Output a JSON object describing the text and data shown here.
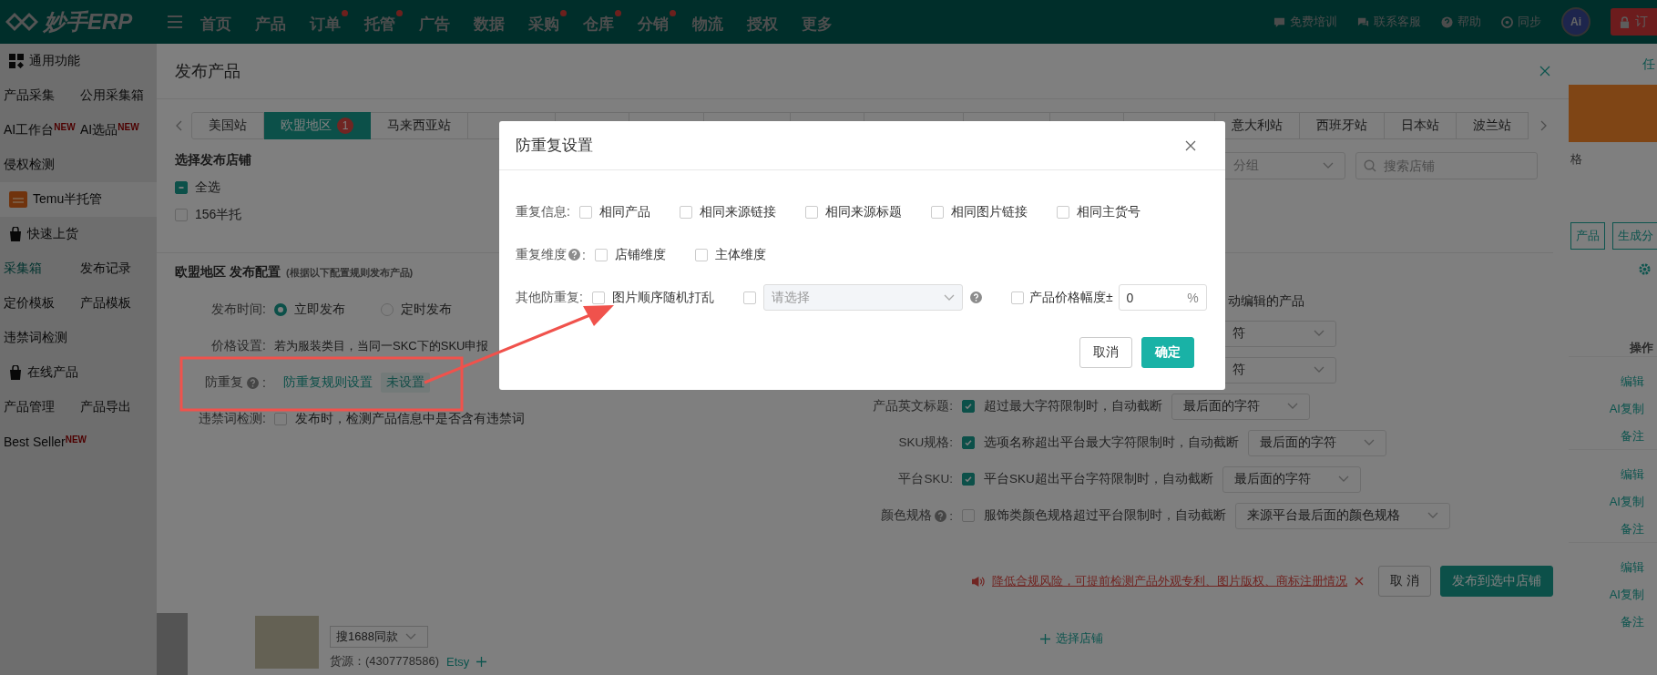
{
  "topbar": {
    "logo": "妙手ERP",
    "nav": [
      {
        "label": "首页",
        "dot": false
      },
      {
        "label": "产品",
        "dot": false
      },
      {
        "label": "订单",
        "dot": true
      },
      {
        "label": "托管",
        "dot": true
      },
      {
        "label": "广告",
        "dot": false
      },
      {
        "label": "数据",
        "dot": false
      },
      {
        "label": "采购",
        "dot": true
      },
      {
        "label": "仓库",
        "dot": true
      },
      {
        "label": "分销",
        "dot": true
      },
      {
        "label": "物流",
        "dot": false
      },
      {
        "label": "授权",
        "dot": false
      },
      {
        "label": "更多",
        "dot": false
      }
    ],
    "tools": [
      {
        "kind": "training",
        "label": "免费培训"
      },
      {
        "kind": "service",
        "label": "联系客服"
      },
      {
        "kind": "help",
        "label": "帮助"
      },
      {
        "kind": "sync",
        "label": "同步"
      }
    ],
    "avatar": "Ai",
    "order_button": "订"
  },
  "sidebar": [
    {
      "kind": "heading",
      "items": [
        {
          "label": "通用功能",
          "selected": false
        }
      ]
    },
    {
      "kind": "plain",
      "items": [
        {
          "label": "产品采集",
          "selected": false
        },
        {
          "label": "公用采集箱",
          "selected": false
        }
      ]
    },
    {
      "kind": "plain",
      "items": [
        {
          "label": "AI工作台",
          "badge": "NEW",
          "selected": false
        },
        {
          "label": "AI选品",
          "badge": "NEW",
          "selected": false
        }
      ]
    },
    {
      "kind": "plain",
      "items": [
        {
          "label": "侵权检测",
          "selected": false
        }
      ]
    },
    {
      "kind": "app",
      "items": [
        {
          "label": "Temu半托管",
          "selected": false
        }
      ]
    },
    {
      "kind": "shortcut",
      "items": [
        {
          "label": "快速上货",
          "selected": false
        }
      ]
    },
    {
      "kind": "plain",
      "items": [
        {
          "label": "采集箱",
          "selected": true
        },
        {
          "label": "发布记录",
          "selected": false
        }
      ]
    },
    {
      "kind": "plain",
      "items": [
        {
          "label": "定价模板",
          "selected": false
        },
        {
          "label": "产品模板",
          "selected": false
        }
      ]
    },
    {
      "kind": "plain",
      "items": [
        {
          "label": "违禁词检测",
          "selected": false
        }
      ]
    },
    {
      "kind": "shortcut",
      "items": [
        {
          "label": "在线产品",
          "selected": false
        }
      ]
    },
    {
      "kind": "plain",
      "items": [
        {
          "label": "产品管理",
          "selected": false
        },
        {
          "label": "产品导出",
          "selected": false
        }
      ]
    },
    {
      "kind": "plain",
      "items": [
        {
          "label": "Best Seller",
          "badge": "NEW",
          "selected": false
        }
      ]
    }
  ],
  "page": {
    "corner_text": "任",
    "column_fragment": "格",
    "buttons": [
      "产品",
      "生成分"
    ],
    "actions_header": "操作",
    "action_groups": [
      [
        "编辑",
        "AI复制",
        "备注"
      ],
      [
        "编辑",
        "AI复制",
        "备注"
      ],
      [
        "编辑",
        "AI复制",
        "备注"
      ]
    ],
    "product": {
      "source_select": "搜1688同款",
      "source": "货源：(4307778586)",
      "platform": "Etsy",
      "store_action": "选择店铺"
    }
  },
  "publish_dialog": {
    "title": "发布产品",
    "tabs": [
      {
        "label": "美国站",
        "selected": false
      },
      {
        "label": "欧盟地区",
        "selected": true,
        "badge": "1"
      },
      {
        "label": "马来西亚站",
        "selected": false
      }
    ],
    "tabs_right": [
      {
        "label": "意大利站",
        "selected": false
      },
      {
        "label": "西班牙站",
        "selected": false
      },
      {
        "label": "日本站",
        "selected": false
      },
      {
        "label": "波兰站",
        "selected": false
      }
    ],
    "store_title": "选择发布店铺",
    "stores": [
      {
        "label": "全选",
        "indeterminate": true
      },
      {
        "label": "156半托",
        "indeterminate": false
      }
    ],
    "group_select": {
      "placeholder": "分组"
    },
    "store_search": {
      "placeholder": "搜索店铺"
    },
    "config_title": "欧盟地区 发布配置",
    "config_hint": "(根据以下配置规则发布产品)",
    "publish_time": {
      "label": "发布时间:",
      "options": [
        {
          "label": "立即发布",
          "selected": true
        },
        {
          "label": "定时发布",
          "selected": false
        }
      ]
    },
    "price": {
      "label": "价格设置:",
      "text": "若为服装类目，当同一SKC下的SKU申报"
    },
    "dedupe": {
      "label": "防重复",
      "colon": ":",
      "link": "防重复规则设置",
      "tag": "未设置"
    },
    "banned_words": {
      "label": "违禁词检测:",
      "checked": false,
      "text": "发布时，检测产品信息中是否含有违禁词"
    },
    "edited_fragment": "动编辑的产品",
    "hidden_row_values": [
      "符",
      "符"
    ],
    "rules": [
      {
        "label": "产品英文标题:",
        "help": false,
        "checked": true,
        "text": "超过最大字符限制时，自动截断",
        "value": "最后面的字符"
      },
      {
        "label": "SKU规格:",
        "help": false,
        "checked": true,
        "text": "选项名称超出平台最大字符限制时，自动截断",
        "value": "最后面的字符"
      },
      {
        "label": "平台SKU:",
        "help": false,
        "checked": true,
        "text": "平台SKU超出平台字符限制时，自动截断",
        "value": "最后面的字符"
      },
      {
        "label": "颜色规格",
        "colon": ":",
        "help": true,
        "checked": false,
        "text": "服饰类颜色规格超过平台限制时，自动截断",
        "value": "来源平台最后面的颜色规格"
      }
    ],
    "notice": "降低合规风险，可提前检测产品外观专利、图片版权、商标注册情况",
    "buttons": [
      {
        "kind": "default",
        "label": "取 消"
      },
      {
        "kind": "primary",
        "label": "发布到选中店铺"
      }
    ]
  },
  "dedupe_dialog": {
    "title": "防重复设置",
    "rows": [
      {
        "label": "重复信息:",
        "help": false,
        "options": [
          {
            "kind": "checkbox",
            "label": "相同产品",
            "checked": false
          },
          {
            "kind": "checkbox",
            "label": "相同来源链接",
            "checked": false
          },
          {
            "kind": "checkbox",
            "label": "相同来源标题",
            "checked": false
          },
          {
            "kind": "checkbox",
            "label": "相同图片链接",
            "checked": false
          },
          {
            "kind": "checkbox",
            "label": "相同主货号",
            "checked": false
          }
        ]
      },
      {
        "label": "重复维度",
        "colon": ":",
        "help": true,
        "options": [
          {
            "kind": "checkbox",
            "label": "店铺维度",
            "checked": false
          },
          {
            "kind": "checkbox",
            "label": "主体维度",
            "checked": false
          }
        ]
      },
      {
        "label": "其他防重复:",
        "help": false,
        "options": [
          {
            "kind": "checkbox",
            "label": "图片顺序随机打乱",
            "checked": false
          },
          {
            "kind": "select",
            "checked": false,
            "placeholder": "请选择",
            "disabled": true
          },
          {
            "kind": "range",
            "checked": false,
            "label": "产品价格幅度±",
            "value": "0",
            "suffix": "%"
          }
        ]
      }
    ],
    "buttons": [
      {
        "kind": "default",
        "label": "取消"
      },
      {
        "kind": "primary",
        "label": "确定"
      }
    ]
  }
}
